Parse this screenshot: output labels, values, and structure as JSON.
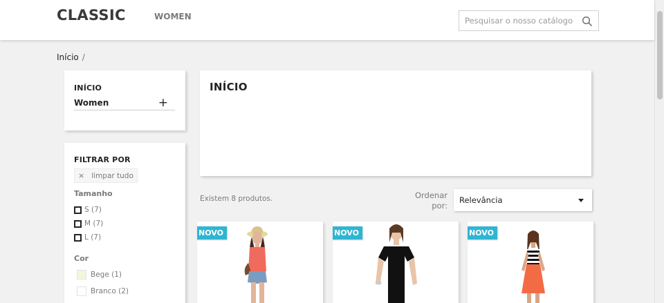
{
  "header": {
    "logo": "CLASSIC",
    "nav": {
      "women": "WOMEN"
    },
    "search": {
      "placeholder": "Pesquisar o nosso catálogo",
      "value": ""
    }
  },
  "breadcrumb": {
    "home": "Início",
    "separator": "/"
  },
  "categories": {
    "title": "INÍCIO",
    "item": "Women",
    "expand_icon": "+"
  },
  "filters": {
    "title": "FILTRAR POR",
    "clear_all": "limpar tudo",
    "clear_icon": "×",
    "size": {
      "title": "Tamanho",
      "options": [
        "S (7)",
        "M (7)",
        "L (7)"
      ]
    },
    "color": {
      "title": "Cor",
      "options": [
        {
          "label": "Bege (1)",
          "color": "#f5f5dc"
        },
        {
          "label": "Branco (2)",
          "color": "#ffffff"
        }
      ]
    }
  },
  "main": {
    "title": "INÍCIO",
    "product_count": "Existem 8 produtos.",
    "sort_label": "Ordenar por:",
    "sort_selected": "Relevância"
  },
  "products": [
    {
      "badge": "NOVO",
      "image": "woman-hat-shorts"
    },
    {
      "badge": "NOVO",
      "image": "woman-black-top"
    },
    {
      "badge": "NOVO",
      "image": "woman-striped-orange-skirt"
    }
  ],
  "colors": {
    "accent": "#2fb5d2",
    "text": "#232323",
    "muted": "#7a7a7a",
    "background": "#f1f1f1"
  }
}
